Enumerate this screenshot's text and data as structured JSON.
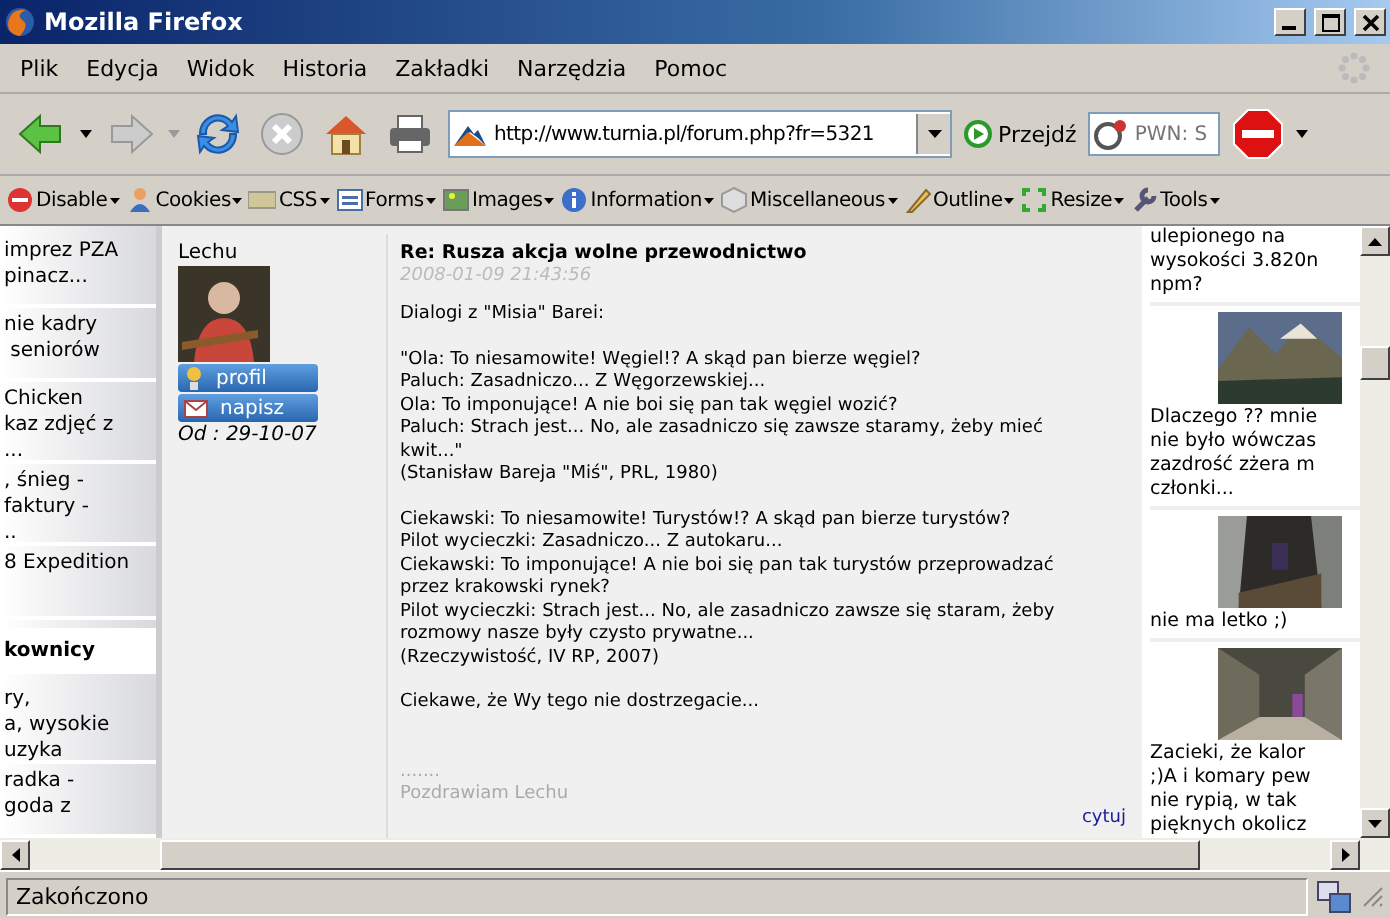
{
  "window": {
    "title": "Mozilla Firefox"
  },
  "menu": [
    "Plik",
    "Edycja",
    "Widok",
    "Historia",
    "Zakładki",
    "Narzędzia",
    "Pomoc"
  ],
  "nav_toolbar": {
    "address": "http://www.turnia.pl/forum.php?fr=5321",
    "go_button": "Przejdź",
    "search_placeholder": "PWN: S"
  },
  "ext_toolbar": [
    "Disable",
    "Cookies",
    "CSS",
    "Forms",
    "Images",
    "Information",
    "Miscellaneous",
    "Outline",
    "Resize",
    "Tools"
  ],
  "sidebar": {
    "items": [
      {
        "text": "imprez PZA\npinacz...",
        "selected": false
      },
      {
        "text": "nie kadry\n seniorów",
        "selected": false
      },
      {
        "text": "Chicken\nkaz zdjęć z\n...",
        "selected": false
      },
      {
        "text": ", śnieg -\nfaktury -\n..",
        "selected": false
      },
      {
        "text": "8 Expedition",
        "selected": false
      },
      {
        "text": "kownicy",
        "selected": true
      },
      {
        "text": "ry,\na, wysokie\nuzyka",
        "selected": false
      },
      {
        "text": "radka -\ngoda z",
        "selected": false
      }
    ]
  },
  "post": {
    "author": "Lechu",
    "profile_button": "profil",
    "message_button": "napisz",
    "joined": "Od : 29-10-07",
    "title": "Re: Rusza akcja wolne przewodnictwo",
    "date": "2008-01-09 21:43:56",
    "paragraphs": [
      "Dialogi z \"Misia\" Barei:",
      "\"Ola: To niesamowite! Węgiel!? A skąd pan bierze węgiel?\nPaluch: Zasadniczo... Z Węgorzewskiej...\nOla: To imponujące! A nie boi się pan tak węgiel wozić?\nPaluch: Strach jest... No, ale zasadniczo się zawsze staramy, żeby mieć\nkwit...\"\n(Stanisław Bareja \"Miś\", PRL, 1980)",
      "Ciekawski: To niesamowite! Turystów!? A skąd pan bierze turystów?\nPilot wycieczki: Zasadniczo... Z autokaru...\nCiekawski: To imponujące! A nie boi się pan tak turystów przeprowadzać\nprzez krakowski rynek?\nPilot wycieczki: Strach jest... No, ale zasadniczo zawsze się staram, żeby\nrozmowy nasze były czysto prywatne...\n(Rzeczywistość, IV RP, 2007)",
      "Ciekawe, że Wy tego nie dostrzegacie..."
    ],
    "signature": ".......\nPozdrawiam Lechu",
    "quote_link": "cytuj"
  },
  "gallery": [
    {
      "kind": "text",
      "text": "ulepionego na\nwysokości 3.820n\nnpm?"
    },
    {
      "kind": "picture"
    },
    {
      "kind": "text",
      "text": "Dlaczego ?? mnie\nnie było wówczas\nzazdrość zżera m\nczłonki..."
    },
    {
      "kind": "picture"
    },
    {
      "kind": "text",
      "text": "nie ma letko ;)"
    },
    {
      "kind": "picture"
    },
    {
      "kind": "text",
      "text": "Zacieki, że kalor\n;)A i komary pew\nnie rypią, w tak\npięknych okolicz"
    }
  ],
  "status_bar": "Zakończono"
}
